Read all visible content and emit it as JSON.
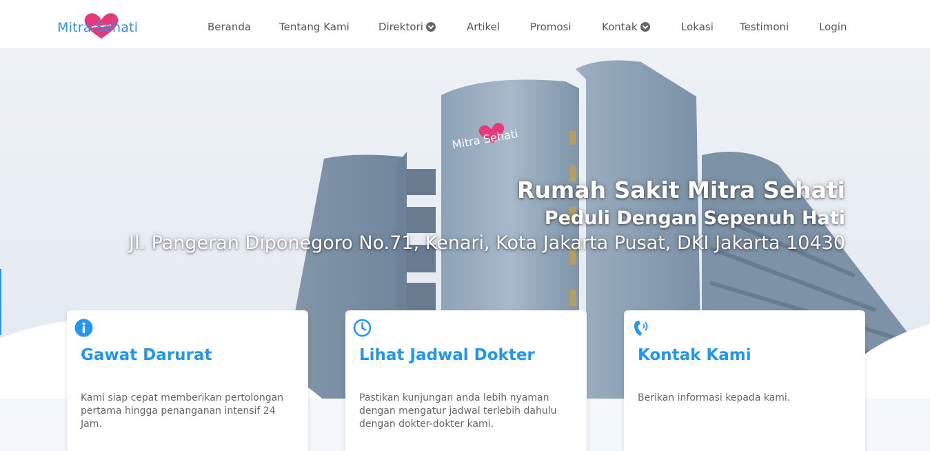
{
  "brand": {
    "logo_text": "Mitra Sehati",
    "primary_color": "#2196f3",
    "heart_color": "#e6397a"
  },
  "nav": {
    "items": [
      {
        "label": "Beranda",
        "dropdown": false
      },
      {
        "label": "Tentang Kami",
        "dropdown": false
      },
      {
        "label": "Direktori",
        "dropdown": true
      },
      {
        "label": "Artikel",
        "dropdown": false
      },
      {
        "label": "Promosi",
        "dropdown": false
      },
      {
        "label": "Kontak",
        "dropdown": true
      },
      {
        "label": "Lokasi",
        "dropdown": false
      },
      {
        "label": "Testimoni",
        "dropdown": false
      },
      {
        "label": "Login",
        "dropdown": false
      }
    ]
  },
  "hero": {
    "title": "Rumah Sakit Mitra Sehati",
    "subtitle": "Peduli Dengan Sepenuh Hati",
    "address": "Jl. Pangeran Diponegoro No.71, Kenari, Kota Jakarta Pusat, DKI Jakarta 10430",
    "building_sign": "Mitra Sehati"
  },
  "cards": [
    {
      "icon": "info-icon",
      "title": "Gawat Darurat",
      "text": "Kami siap cepat memberikan pertolongan pertama hingga penanganan intensif 24 Jam."
    },
    {
      "icon": "clock-icon",
      "title": "Lihat Jadwal Dokter",
      "text": "Pastikan kunjungan anda lebih nyaman dengan mengatur jadwal terlebih dahulu dengan dokter-dokter kami."
    },
    {
      "icon": "phone-icon",
      "title": "Kontak Kami",
      "text": "Berikan informasi kepada kami."
    }
  ]
}
